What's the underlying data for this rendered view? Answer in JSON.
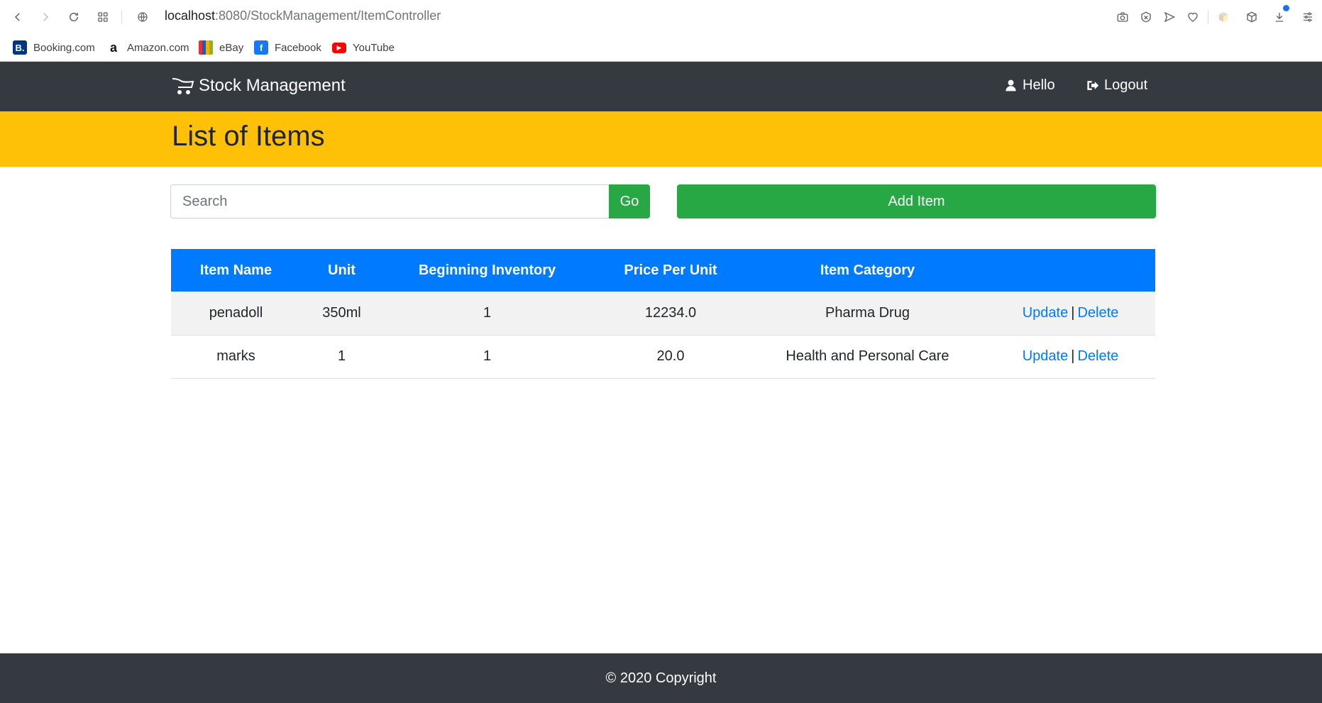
{
  "browser": {
    "url_host": "localhost",
    "url_rest": ":8080/StockManagement/ItemController",
    "bookmarks": [
      {
        "label": "Booking.com",
        "icon": "booking-icon",
        "icon_text": "B.",
        "color": "#003580"
      },
      {
        "label": "Amazon.com",
        "icon": "amazon-icon",
        "icon_text": "a",
        "color": "#ffffff"
      },
      {
        "label": "eBay",
        "icon": "ebay-icon",
        "icon_text": "",
        "color": "#e53238"
      },
      {
        "label": "Facebook",
        "icon": "facebook-icon",
        "icon_text": "f",
        "color": "#1877f2"
      },
      {
        "label": "YouTube",
        "icon": "youtube-icon",
        "icon_text": "▶",
        "color": "#ff0000"
      }
    ]
  },
  "navbar": {
    "brand": "Stock Management",
    "hello": "Hello",
    "logout": "Logout"
  },
  "header": {
    "title": "List of Items"
  },
  "search": {
    "placeholder": "Search",
    "value": "",
    "go_label": "Go"
  },
  "add_item_label": "Add Item",
  "table": {
    "columns": [
      "Item Name",
      "Unit",
      "Beginning Inventory",
      "Price Per Unit",
      "Item Category",
      ""
    ],
    "rows": [
      {
        "name": "penadoll",
        "unit": "350ml",
        "inventory": "1",
        "price": "12234.0",
        "category": "Pharma Drug",
        "update": "Update",
        "delete": "Delete"
      },
      {
        "name": "marks",
        "unit": "1",
        "inventory": "1",
        "price": "20.0",
        "category": "Health and Personal Care",
        "update": "Update",
        "delete": "Delete"
      }
    ],
    "separator": "|"
  },
  "footer": {
    "text": "© 2020 Copyright"
  },
  "colors": {
    "navbar": "#343a40",
    "header": "#ffc107",
    "table_head": "#007bff",
    "button": "#28a745",
    "link": "#007bff"
  }
}
